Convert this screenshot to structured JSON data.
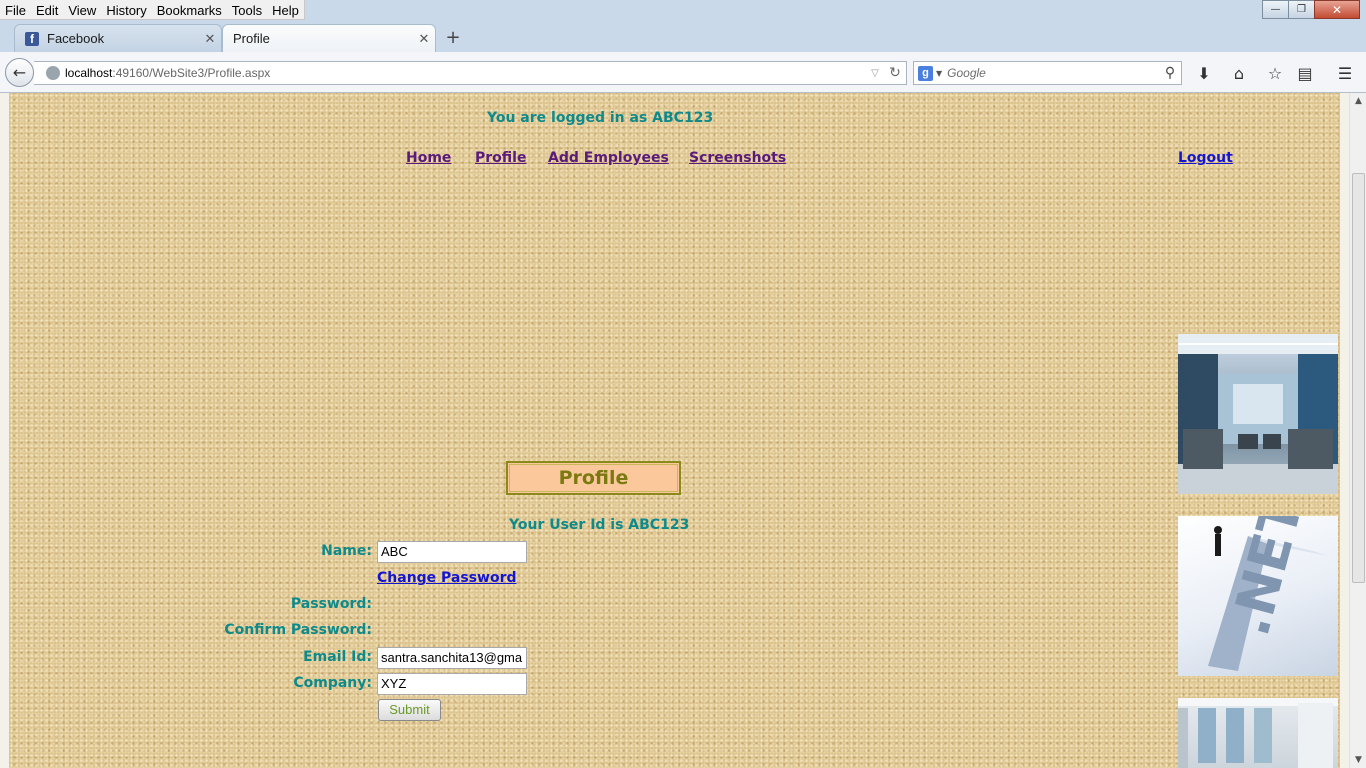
{
  "menu": {
    "items": [
      {
        "label": "File"
      },
      {
        "label": "Edit"
      },
      {
        "label": "View"
      },
      {
        "label": "History"
      },
      {
        "label": "Bookmarks"
      },
      {
        "label": "Tools"
      },
      {
        "label": "Help"
      }
    ]
  },
  "tabs": [
    {
      "label": "Facebook",
      "favicon": "facebook-icon"
    },
    {
      "label": "Profile",
      "favicon": "none"
    }
  ],
  "address": {
    "host": "localhost",
    "path": ":49160/WebSite3/Profile.aspx"
  },
  "search": {
    "placeholder": "Google",
    "engine_icon": "google-icon"
  },
  "site": {
    "logged_in_text": "You are logged in as ABC123",
    "nav": {
      "home": "Home",
      "profile": "Profile",
      "add_employees": "Add Employees",
      "screenshots": "Screenshots",
      "logout": "Logout"
    },
    "profile_heading": "Profile",
    "user_id_text": "Your User Id is ABC123",
    "form": {
      "name_label": "Name:",
      "name_value": "ABC",
      "change_password": "Change Password",
      "password_label": "Password:",
      "confirm_password_label": "Confirm Password:",
      "email_label": "Email Id:",
      "email_value": "santra.sanchita13@gma",
      "company_label": "Company:",
      "company_value": "XYZ",
      "submit_label": "Submit"
    },
    "side_images": {
      "net_label": ".NET"
    }
  },
  "colors": {
    "teal_text": "#0e8a8a",
    "visited_link": "#5a1a7a",
    "link_blue": "#1515d0",
    "profile_box_bg": "#fbc89c"
  }
}
